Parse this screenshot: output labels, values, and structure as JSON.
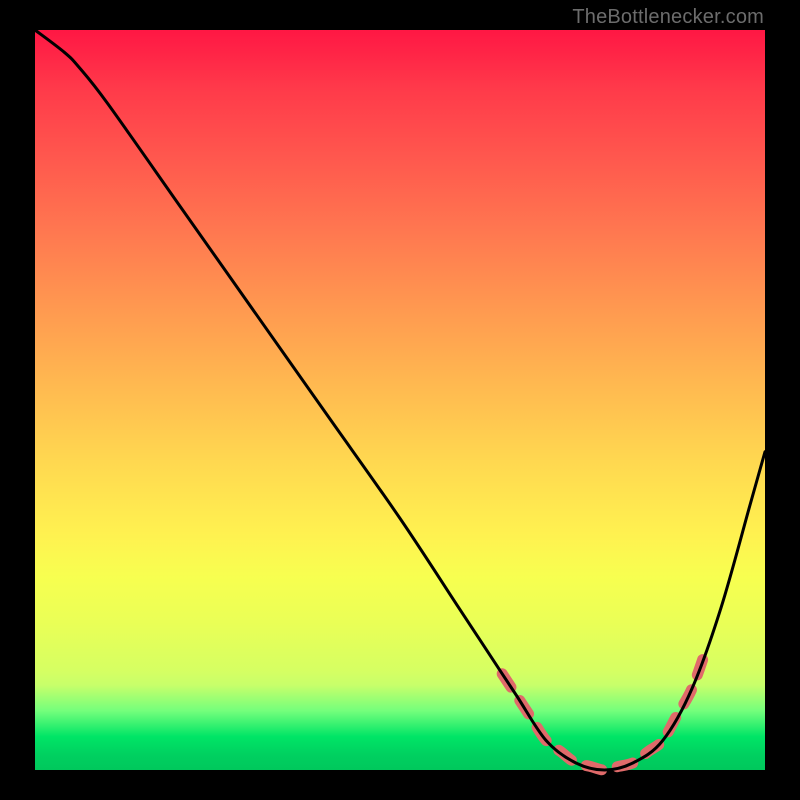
{
  "attribution": "TheBottlenecker.com",
  "colors": {
    "background": "#000000",
    "gradient_top": "#ff1744",
    "gradient_mid": "#ffd750",
    "gradient_bottom": "#00c85c",
    "curve": "#000000",
    "highlight_dash": "#e06a6a"
  },
  "chart_data": {
    "type": "line",
    "title": "",
    "xlabel": "",
    "ylabel": "",
    "xlim": [
      0,
      100
    ],
    "ylim": [
      0,
      100
    ],
    "note": "Axes have no tick labels; x and y are normalized 0–100. y≈100 means top (worst / red), y≈0 means bottom (best / green). Curve is a bottleneck-style V shape with minimum near x≈78.",
    "series": [
      {
        "name": "bottleneck-curve",
        "x": [
          0,
          4,
          6,
          10,
          20,
          30,
          40,
          50,
          58,
          62,
          66,
          70,
          74,
          78,
          82,
          86,
          90,
          94,
          98,
          100
        ],
        "y": [
          100,
          97,
          95,
          90,
          76,
          62,
          48,
          34,
          22,
          16,
          10,
          4,
          1,
          0,
          1,
          4,
          11,
          22,
          36,
          43
        ]
      }
    ],
    "highlight_range": {
      "name": "optimal-zone",
      "x_start": 64,
      "x_end": 92,
      "description": "Dashed coral segment along the trough of the curve marking the low-bottleneck region."
    }
  }
}
